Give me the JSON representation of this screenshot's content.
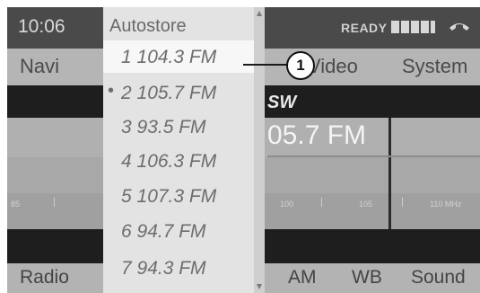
{
  "status_bar": {
    "time": "10:06",
    "ready": "READY"
  },
  "top_menu": {
    "navi": "Navi",
    "video": "Video",
    "system": "System"
  },
  "main": {
    "band_label": "SW",
    "frequency": "05.7 FM",
    "scale": [
      "85",
      "100",
      "105",
      "110 MHz"
    ]
  },
  "bottom_menu": {
    "radio": "Radio",
    "am": "AM",
    "wb": "WB",
    "sound": "Sound"
  },
  "autostore": {
    "title": "Autostore",
    "items": [
      "1 104.3 FM",
      "2 105.7 FM",
      "3 93.5 FM",
      "4 106.3 FM",
      "5 107.3 FM",
      "6 94.7 FM",
      "7 94.3 FM"
    ],
    "bullet": "•",
    "selected_index": 0,
    "current_index": 1
  },
  "callout": "1",
  "icons": {
    "battery": "signal-strength-icon",
    "phone": "phone-icon",
    "scroll_up": "scroll-up-arrow-icon",
    "scroll_down": "scroll-down-arrow-icon"
  }
}
